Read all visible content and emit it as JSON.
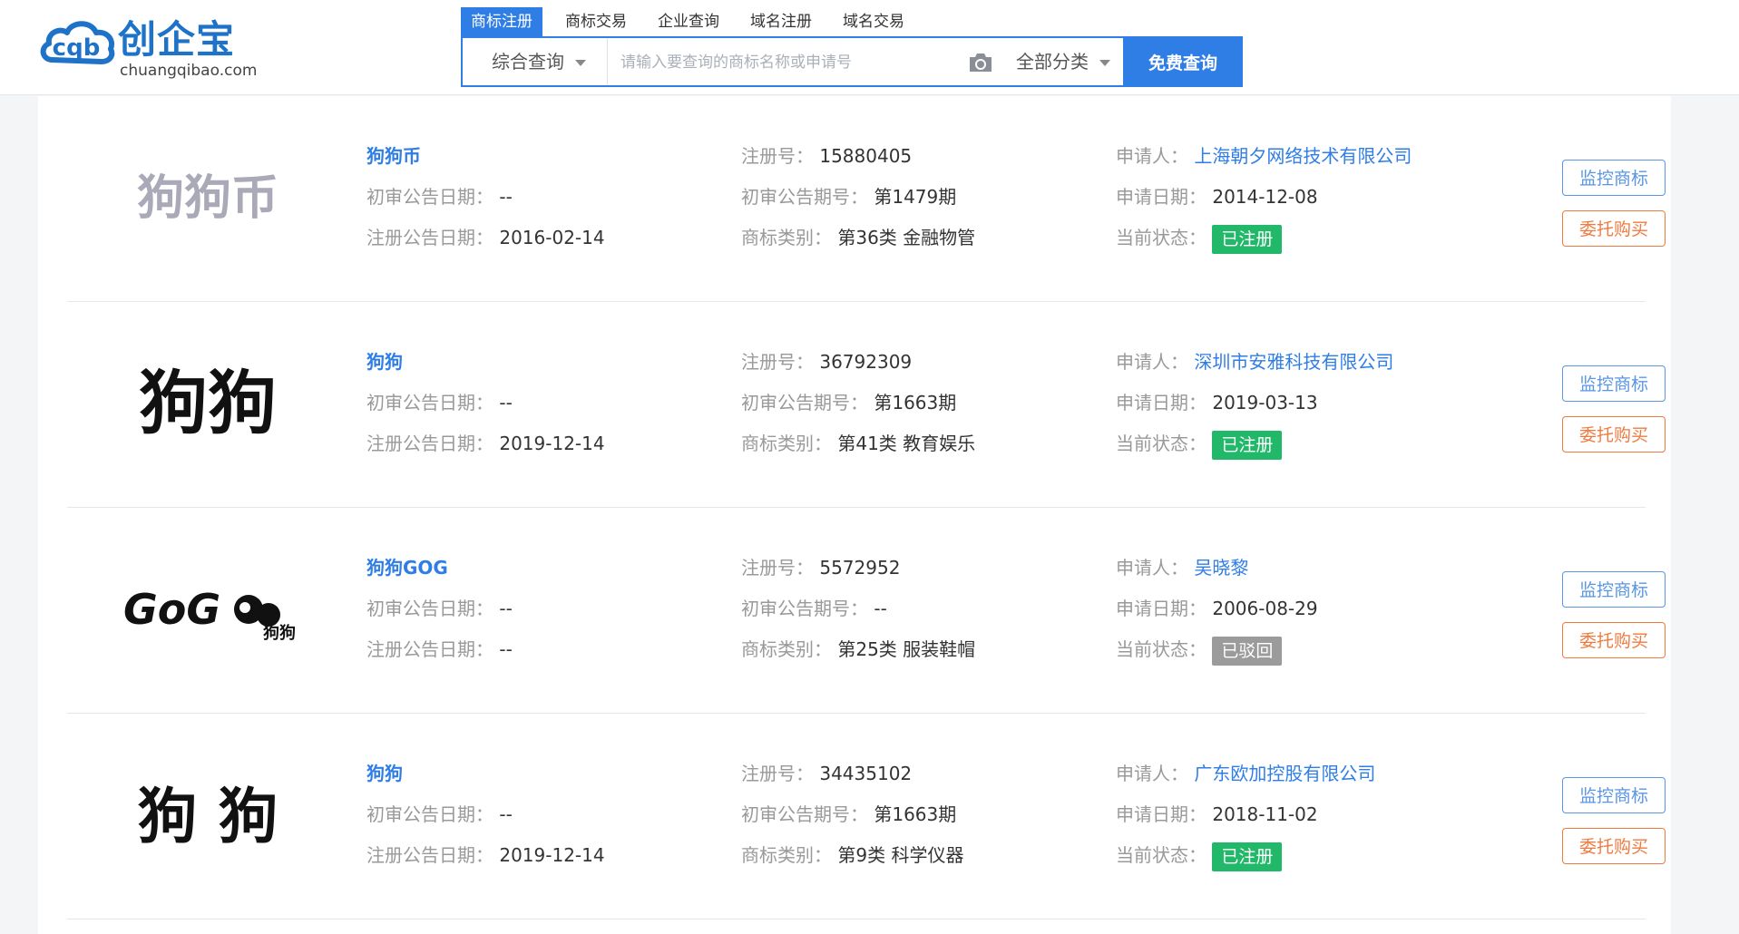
{
  "header": {
    "logo_cn": "创企宝",
    "logo_en": "chuangqibao.com",
    "logo_mark": "cqb",
    "tabs": [
      "商标注册",
      "商标交易",
      "企业查询",
      "域名注册",
      "域名交易"
    ],
    "active_tab": "商标注册",
    "search_type": "综合查询",
    "search_placeholder": "请输入要查询的商标名称或申请号",
    "search_value": "",
    "category": "全部分类",
    "search_button": "免费查询",
    "camera_icon": "camera-icon"
  },
  "labels": {
    "reg_no": "注册号：",
    "prelim_date": "初审公告日期：",
    "reg_date": "注册公告日期：",
    "prelim_issue": "初审公告期号：",
    "category": "商标类别：",
    "applicant": "申请人：",
    "apply_date": "申请日期：",
    "status": "当前状态：",
    "monitor_btn": "监控商标",
    "buy_btn": "委托购买"
  },
  "results": [
    {
      "name": "狗狗币",
      "logo_text": "狗狗币",
      "reg_no": "15880405",
      "prelim_date": "--",
      "reg_date": "2016-02-14",
      "prelim_issue": "第1479期",
      "category": "第36类 金融物管",
      "applicant": "上海朝夕网络技术有限公司",
      "apply_date": "2014-12-08",
      "status": "已注册",
      "status_color": "#21b86a"
    },
    {
      "name": "狗狗",
      "logo_text": "狗狗",
      "reg_no": "36792309",
      "prelim_date": "--",
      "reg_date": "2019-12-14",
      "prelim_issue": "第1663期",
      "category": "第41类 教育娱乐",
      "applicant": "深圳市安雅科技有限公司",
      "apply_date": "2019-03-13",
      "status": "已注册",
      "status_color": "#21b86a"
    },
    {
      "name": "狗狗GOG",
      "logo_text": "GoG",
      "logo_subtext": "狗狗",
      "reg_no": "5572952",
      "prelim_date": "--",
      "reg_date": "--",
      "prelim_issue": "--",
      "category": "第25类 服装鞋帽",
      "applicant": "吴晓黎",
      "apply_date": "2006-08-29",
      "status": "已驳回",
      "status_color": "#9b9b9b"
    },
    {
      "name": "狗狗",
      "logo_text": "狗 狗",
      "reg_no": "34435102",
      "prelim_date": "--",
      "reg_date": "2019-12-14",
      "prelim_issue": "第1663期",
      "category": "第9类 科学仪器",
      "applicant": "广东欧加控股有限公司",
      "apply_date": "2018-11-02",
      "status": "已注册",
      "status_color": "#21b86a"
    }
  ],
  "colors": {
    "brand": "#1e73c9",
    "accent": "#2f7ee6",
    "registered": "#21b86a",
    "rejected": "#9b9b9b",
    "buy": "#f07a3e"
  }
}
